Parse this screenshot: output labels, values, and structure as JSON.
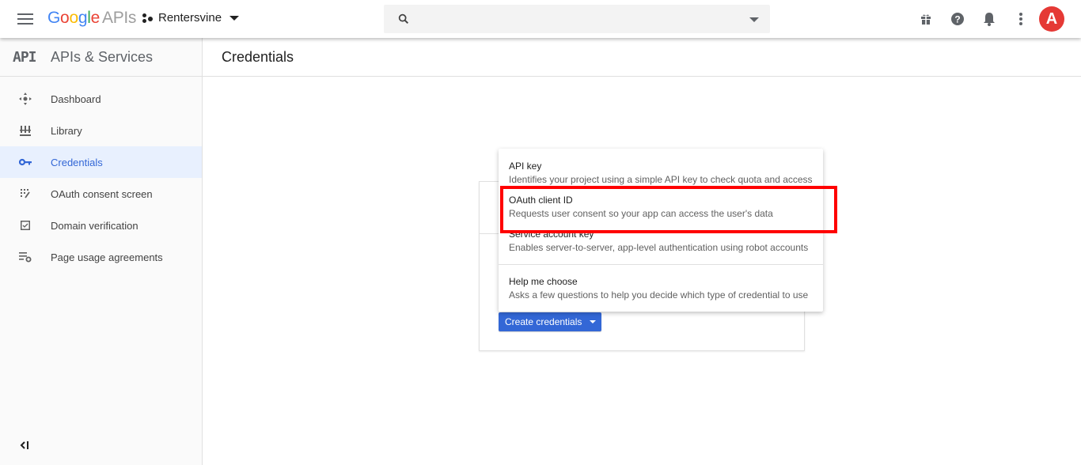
{
  "topbar": {
    "logo_google": [
      "G",
      "o",
      "o",
      "g",
      "l",
      "e"
    ],
    "logo_apis": "APIs",
    "project_name": "Rentersvine",
    "search_placeholder": "",
    "icons": [
      "menu-icon",
      "search-icon",
      "gift-icon",
      "help-icon",
      "notifications-icon",
      "more-vert-icon"
    ],
    "avatar_letter": "A"
  },
  "sidebar": {
    "logo": "API",
    "title": "APIs & Services",
    "items": [
      {
        "label": "Dashboard",
        "icon": "dashboard-icon",
        "active": false
      },
      {
        "label": "Library",
        "icon": "library-icon",
        "active": false
      },
      {
        "label": "Credentials",
        "icon": "key-icon",
        "active": true
      },
      {
        "label": "OAuth consent screen",
        "icon": "consent-icon",
        "active": false
      },
      {
        "label": "Domain verification",
        "icon": "checkbox-icon",
        "active": false
      },
      {
        "label": "Page usage agreements",
        "icon": "settings-list-icon",
        "active": false
      }
    ],
    "collapse_icon": "collapse-icon"
  },
  "main": {
    "page_title": "Credentials",
    "create_button_label": "Create credentials",
    "menu": [
      {
        "title": "API key",
        "description": "Identifies your project using a simple API key to check quota and access"
      },
      {
        "title": "OAuth client ID",
        "description": "Requests user consent so your app can access the user's data"
      },
      {
        "title": "Service account key",
        "description": "Enables server-to-server, app-level authentication using robot accounts"
      },
      {
        "title": "Help me choose",
        "description": "Asks a few questions to help you decide which type of credential to use"
      }
    ],
    "highlighted_item": "OAuth client ID"
  },
  "colors": {
    "accent": "#3367d6",
    "active_bg": "#e8f0fe",
    "highlight": "#ff0000",
    "avatar": "#e53935"
  }
}
